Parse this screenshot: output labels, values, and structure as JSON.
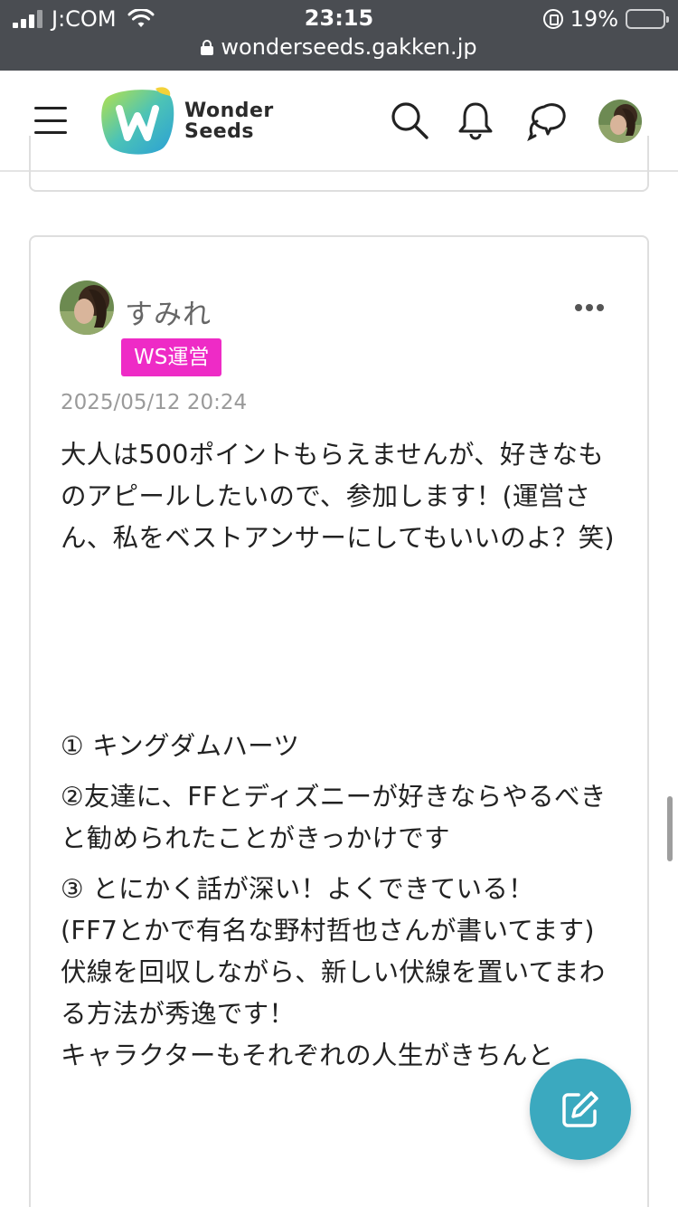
{
  "status_bar": {
    "carrier": "J:COM",
    "time": "23:15",
    "battery": "19%",
    "battery_level": 0.19,
    "url": "wonderseeds.gakken.jp"
  },
  "header": {
    "logo_line1": "Wonder",
    "logo_line2": "Seeds",
    "icons": [
      "menu-icon",
      "search-icon",
      "bell-icon",
      "chat-icon",
      "avatar"
    ]
  },
  "answer": {
    "username": "すみれ",
    "badge": "WS運営",
    "badge_color": "#ee2bc6",
    "date": "2025/05/12 20:24",
    "intro": "大人は500ポイントもらえませんが、好きなものアピールしたいので、参加します！(運営さん、私をベストアンサーにしてもいいのよ？笑)",
    "item1": "① キングダムハーツ",
    "item2": "②友達に、FFとディズニーが好きならやるべきと勧められたことがきっかけです",
    "item3_lines": [
      "③ とにかく話が深い！よくできている！",
      "(FF7とかで有名な野村哲也さんが書いてます)",
      "伏線を回収しながら、新しい伏線を置いてまわる方法が秀逸です！",
      "キャラクターもそれぞれの人生がきちんと"
    ]
  },
  "fab": {
    "icon": "edit-icon",
    "color": "#3ba9bf"
  }
}
